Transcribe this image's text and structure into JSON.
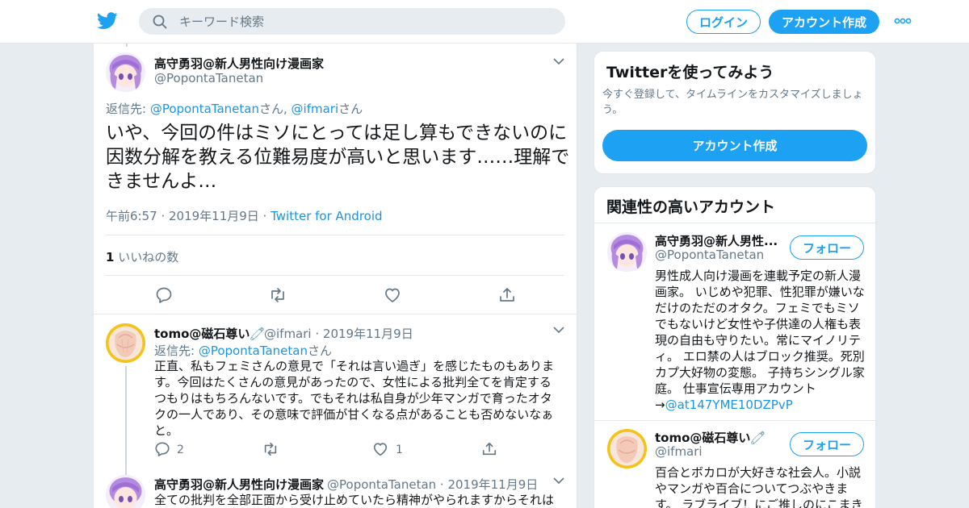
{
  "nav": {
    "search_placeholder": "キーワード検索",
    "login_label": "ログイン",
    "signup_label": "アカウント作成"
  },
  "main_tweet": {
    "name": "高守勇羽@新人男性向け漫画家",
    "handle": "@PopontaTanetan",
    "reply_prefix": "返信先: ",
    "reply_user1": "@PopontaTanetan",
    "reply_san1": "さん, ",
    "reply_user2": "@ifmari",
    "reply_san2": "さん",
    "text": "いや、今回の件はミソにとっては足し算もできないのに因数分解を教える位難易度が高いと思います……理解できませんよ…",
    "time": "午前6:57 · 2019年11月9日 · ",
    "source": "Twitter for Android",
    "likes_count": "1",
    "likes_label": " いいねの数"
  },
  "reply1": {
    "name": "tomo@磁石尊い🧷",
    "handle": "@ifmari",
    "date": " · 2019年11月9日",
    "reply_prefix": "返信先: ",
    "reply_user": "@PopontaTanetan",
    "reply_san": "さん",
    "text": "正直、私もフェミさんの意見で「それは言い過ぎ」を感じたものもあります。今回はたくさんの意見があったので、女性による批判全てを肯定するつもりはもちろんないです。でもそれは私自身が少年マンガで育ったオタクの一人であり、その意味で評価が甘くなる点があることも否めないなぁと。",
    "reply_count": "2",
    "like_count": "1"
  },
  "reply2": {
    "name": "高守勇羽@新人男性向け漫画家",
    "handle": "@PopontaTanetan",
    "date": " · 2019年11月9日",
    "text": "全ての批判を全部正面から受け止めていたら精神がやられますからそれは"
  },
  "signup_card": {
    "title": "Twitterを使ってみよう",
    "subtitle": "今すぐ登録して、タイムラインをカスタマイズしましょう。",
    "button": "アカウント作成"
  },
  "related_card": {
    "title": "関連性の高いアカウント",
    "follow_label": "フォロー",
    "accounts": [
      {
        "name": "高守勇羽@新人男性...",
        "handle": "@PopontaTanetan",
        "bio": "男性成人向け漫画を連載予定の新人漫画家。 いじめや犯罪、性犯罪が嫌いなだけのただのオタク。フェミでもミソでもないけど女性や子供達の人権も表現の自由も守りたい。常にマイノリティ。 エロ禁の人はブロック推奨。死別カプ大好物の変態。 子持ちシングル家庭。 仕事宣伝専用アカウント→",
        "bio_link": "@at147YME10DZPvP"
      },
      {
        "name": "tomo@磁石尊い🧷",
        "handle": "@ifmari",
        "bio": "百合とボカロが大好きな社会人。小説やマンガや百合についてつぶやきます。 ラブライブ！にご推しのにこまき"
      }
    ]
  },
  "colors": {
    "accent": "#1da1f2",
    "link": "#1b95e0",
    "muted": "#657786",
    "background": "#e6ecf0"
  }
}
